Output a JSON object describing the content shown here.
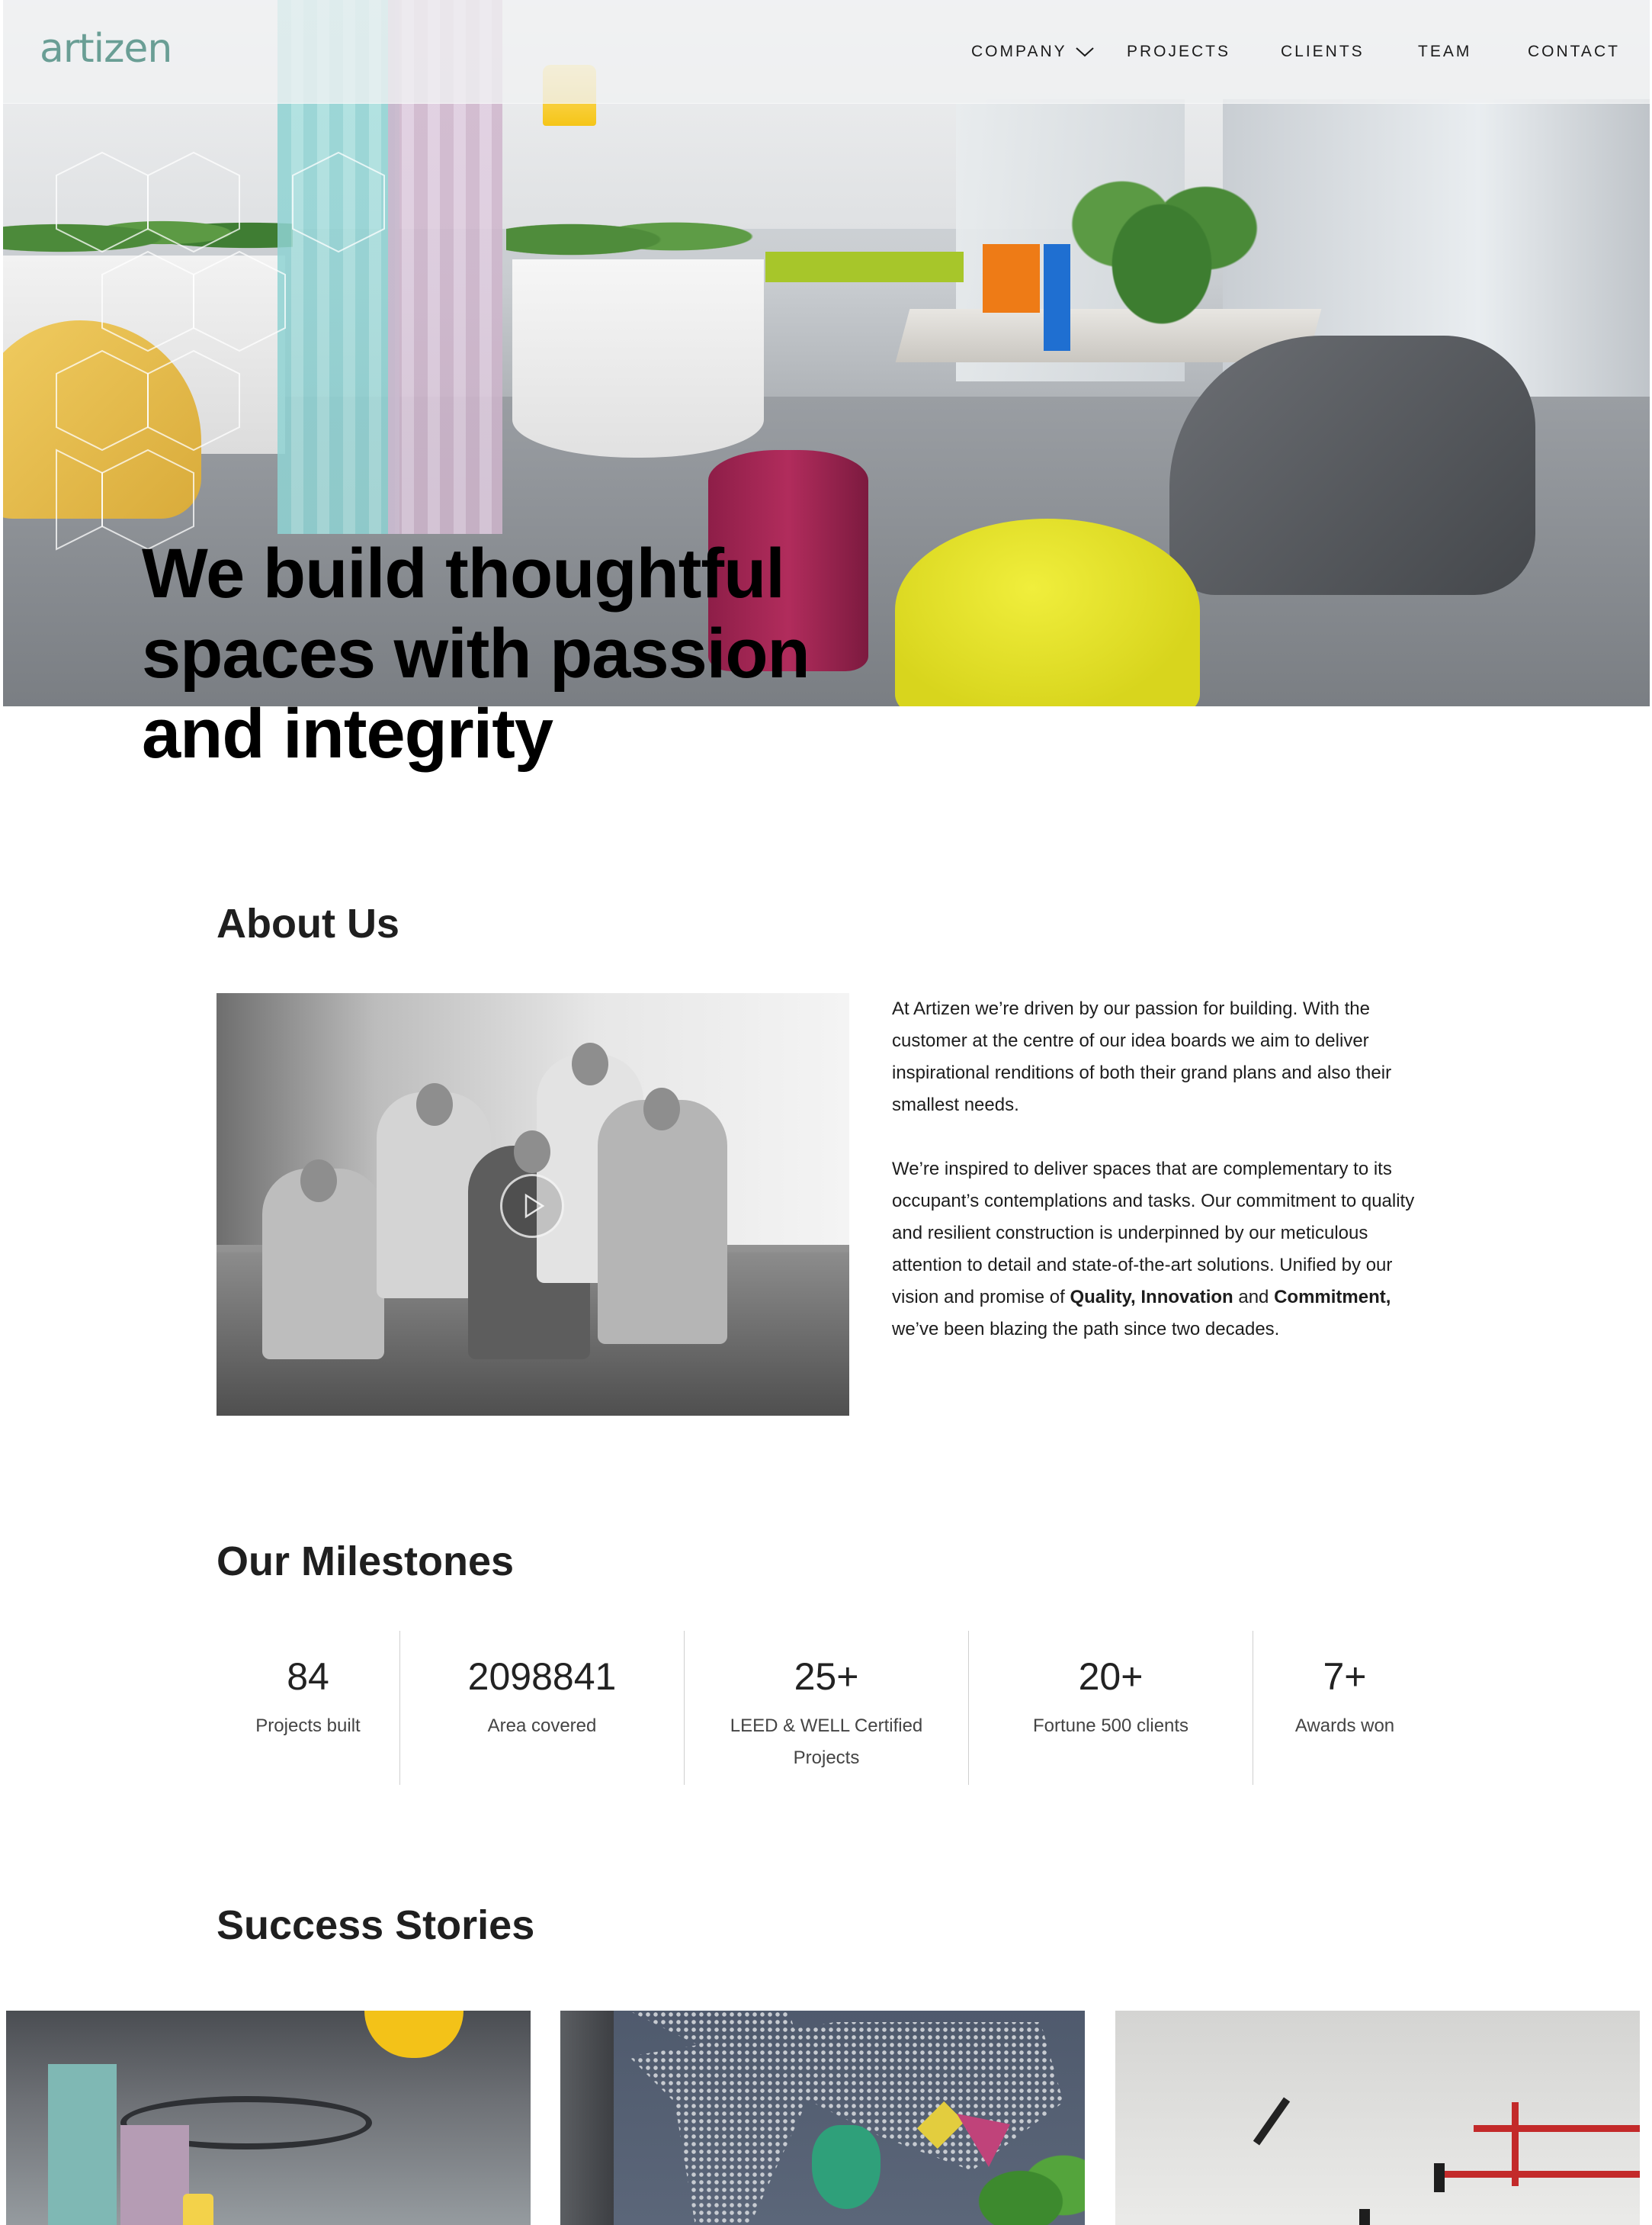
{
  "brand": {
    "logo": "artizen",
    "logo_color": "#6a9e95"
  },
  "nav": {
    "items": [
      {
        "label": "COMPANY",
        "has_dropdown": true
      },
      {
        "label": "PROJECTS"
      },
      {
        "label": "CLIENTS"
      },
      {
        "label": "TEAM"
      },
      {
        "label": "CONTACT"
      }
    ]
  },
  "hero": {
    "headline_lines": [
      "We build thoughtful",
      "spaces with passion",
      "and integrity"
    ]
  },
  "about": {
    "title": "About Us",
    "paragraph1": "At Artizen we’re driven by our passion for building. With the customer at the centre of our idea boards we aim to deliver inspirational renditions of both their grand plans and also their smallest needs.",
    "paragraph2_a": "We’re inspired to deliver spaces that are complementary to its occupant’s contemplations and tasks. Our commitment to quality and resilient construction is underpinned by our meticulous attention to detail and state-of-the-art solutions. Unified by our vision and promise of ",
    "paragraph2_b1": "Quality, Innovation",
    "paragraph2_c": " and ",
    "paragraph2_b2": "Commitment,",
    "paragraph2_d": " we’ve been blazing the path since two decades.",
    "video_icon": "play-icon"
  },
  "milestones": {
    "title": "Our Milestones",
    "items": [
      {
        "value": "84",
        "label": "Projects built"
      },
      {
        "value": "2098841",
        "label": "Area covered"
      },
      {
        "value": "25+",
        "label": "LEED & WELL Certified Projects"
      },
      {
        "value": "20+",
        "label": "Fortune 500 clients"
      },
      {
        "value": "7+",
        "label": "Awards won"
      }
    ]
  },
  "stories": {
    "title": "Success Stories"
  }
}
